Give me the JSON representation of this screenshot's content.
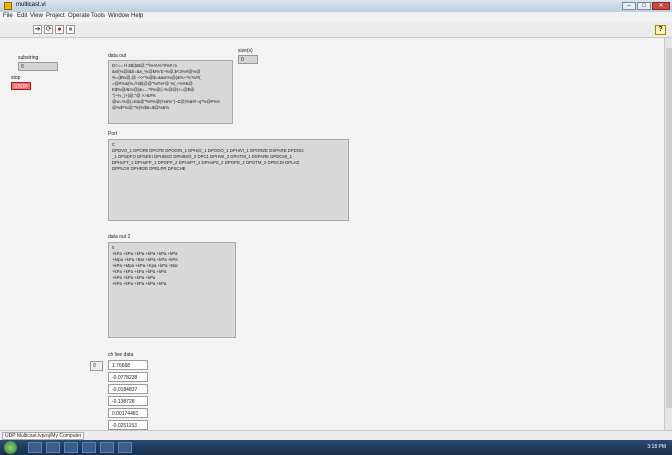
{
  "window": {
    "title": "multicast.vi"
  },
  "menu": [
    "File",
    "Edit",
    "View",
    "Project",
    "Operate",
    "Tools",
    "Window",
    "Help"
  ],
  "toolbar": {
    "run": "➔",
    "run_cont": "⟳",
    "abort": "●",
    "pause": "⏸",
    "help": "?"
  },
  "controls": {
    "substring": {
      "label": "substring",
      "value": "0"
    },
    "stop": {
      "label": "stop",
      "button": "STOP"
    },
    "size": {
      "label": "size(s)",
      "value": "0"
    },
    "data_out": {
      "label": "data out",
      "lines": [
        "D<== H    3B(5B@,\"^l%%%^#%# m",
        "&s/(%@/&h=&e_%@M%'E-%@,$<3%#@%@",
        "%=($%@,@ ->>\"%@$=&&m%@(&%+'%'%/#(",
        "=@#%&(%,/%$(@@\"%/%#@   %(,+%#&@",
        "E$%@/&%@(&=...*#%@(=%@@(<=@$@",
        "\"(~%_(+)@;\"@  >>&#%",
        "@w=%@(=E&@\"%#%@(%&%\"(~Z@(%&#\\~q\"%@#%S",
        "@%$*%@:\"%(%$&=$@%&%"
      ]
    },
    "port": {
      "label": "Port",
      "lines": [
        "C",
        "DPDVO_1  DPOR0  DPOTE  DPOGIN_1  DPHIG_1  DPOGO_1  DPHIVI_1  DPORZE  DSPARE  DPDOI2",
        "_1   DPSDFO  DPSEEI  DPHBSO  DPHBSO_2  DPC1  DPHWI_2  DPHTM_1  DSPARE  DPDCMI_1",
        "DPHoFT_1  DPHoFP_1  DPOPP_2  DPHoPT_2  DPHoPS_2  DPOPD_2  DPOTM_2  DPDCDI  DPLHZ",
        "DPPLOX  DPHR2E  DPELPR  DPSCHE"
      ]
    },
    "data_out_2": {
      "label": "data out 2",
      "lines": [
        "0",
        "+kPa   +kPa   +kPa   +kPa   +kPa   +kPa",
        "   +Mpa   +kPa   +Bar   +kPa   +kPa   +kPa",
        "   +kPa   +Mpa   +kPa   +Kpa   +kPa   +Bar",
        "+kPa   +kPa   +kPa   +kPa   +kPa",
        "   +kPa   +kPa   +kPa   +kPa",
        "   +kPa   +kPa   +kPa   +kPa   +kPa"
      ]
    },
    "ch_live_data": {
      "label": "ch live data",
      "index": "0",
      "values": [
        "1.76668",
        "-0.0778238",
        "-0.0184837",
        "-0.138728",
        "0.00174481",
        "-0.0251153"
      ]
    }
  },
  "status": {
    "text": "UDP Multicast.lvproj/My Computer"
  },
  "tray": {
    "time": "3:18 PM"
  },
  "colors": {
    "stop": "#ff6b6b",
    "indicator_bg": "#d8d8d8"
  }
}
